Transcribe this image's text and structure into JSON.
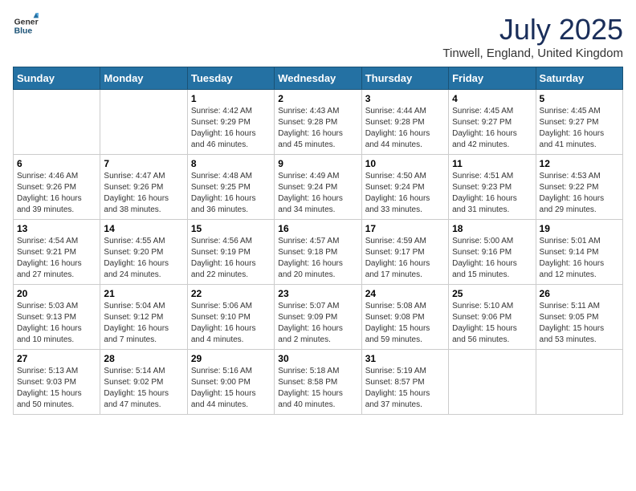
{
  "header": {
    "logo_line1": "General",
    "logo_line2": "Blue",
    "month_year": "July 2025",
    "location": "Tinwell, England, United Kingdom"
  },
  "weekdays": [
    "Sunday",
    "Monday",
    "Tuesday",
    "Wednesday",
    "Thursday",
    "Friday",
    "Saturday"
  ],
  "weeks": [
    [
      {
        "day": "",
        "empty": true
      },
      {
        "day": "",
        "empty": true
      },
      {
        "day": "1",
        "sunrise": "4:42 AM",
        "sunset": "9:29 PM",
        "daylight": "16 hours and 46 minutes."
      },
      {
        "day": "2",
        "sunrise": "4:43 AM",
        "sunset": "9:28 PM",
        "daylight": "16 hours and 45 minutes."
      },
      {
        "day": "3",
        "sunrise": "4:44 AM",
        "sunset": "9:28 PM",
        "daylight": "16 hours and 44 minutes."
      },
      {
        "day": "4",
        "sunrise": "4:45 AM",
        "sunset": "9:27 PM",
        "daylight": "16 hours and 42 minutes."
      },
      {
        "day": "5",
        "sunrise": "4:45 AM",
        "sunset": "9:27 PM",
        "daylight": "16 hours and 41 minutes."
      }
    ],
    [
      {
        "day": "6",
        "sunrise": "4:46 AM",
        "sunset": "9:26 PM",
        "daylight": "16 hours and 39 minutes."
      },
      {
        "day": "7",
        "sunrise": "4:47 AM",
        "sunset": "9:26 PM",
        "daylight": "16 hours and 38 minutes."
      },
      {
        "day": "8",
        "sunrise": "4:48 AM",
        "sunset": "9:25 PM",
        "daylight": "16 hours and 36 minutes."
      },
      {
        "day": "9",
        "sunrise": "4:49 AM",
        "sunset": "9:24 PM",
        "daylight": "16 hours and 34 minutes."
      },
      {
        "day": "10",
        "sunrise": "4:50 AM",
        "sunset": "9:24 PM",
        "daylight": "16 hours and 33 minutes."
      },
      {
        "day": "11",
        "sunrise": "4:51 AM",
        "sunset": "9:23 PM",
        "daylight": "16 hours and 31 minutes."
      },
      {
        "day": "12",
        "sunrise": "4:53 AM",
        "sunset": "9:22 PM",
        "daylight": "16 hours and 29 minutes."
      }
    ],
    [
      {
        "day": "13",
        "sunrise": "4:54 AM",
        "sunset": "9:21 PM",
        "daylight": "16 hours and 27 minutes."
      },
      {
        "day": "14",
        "sunrise": "4:55 AM",
        "sunset": "9:20 PM",
        "daylight": "16 hours and 24 minutes."
      },
      {
        "day": "15",
        "sunrise": "4:56 AM",
        "sunset": "9:19 PM",
        "daylight": "16 hours and 22 minutes."
      },
      {
        "day": "16",
        "sunrise": "4:57 AM",
        "sunset": "9:18 PM",
        "daylight": "16 hours and 20 minutes."
      },
      {
        "day": "17",
        "sunrise": "4:59 AM",
        "sunset": "9:17 PM",
        "daylight": "16 hours and 17 minutes."
      },
      {
        "day": "18",
        "sunrise": "5:00 AM",
        "sunset": "9:16 PM",
        "daylight": "16 hours and 15 minutes."
      },
      {
        "day": "19",
        "sunrise": "5:01 AM",
        "sunset": "9:14 PM",
        "daylight": "16 hours and 12 minutes."
      }
    ],
    [
      {
        "day": "20",
        "sunrise": "5:03 AM",
        "sunset": "9:13 PM",
        "daylight": "16 hours and 10 minutes."
      },
      {
        "day": "21",
        "sunrise": "5:04 AM",
        "sunset": "9:12 PM",
        "daylight": "16 hours and 7 minutes."
      },
      {
        "day": "22",
        "sunrise": "5:06 AM",
        "sunset": "9:10 PM",
        "daylight": "16 hours and 4 minutes."
      },
      {
        "day": "23",
        "sunrise": "5:07 AM",
        "sunset": "9:09 PM",
        "daylight": "16 hours and 2 minutes."
      },
      {
        "day": "24",
        "sunrise": "5:08 AM",
        "sunset": "9:08 PM",
        "daylight": "15 hours and 59 minutes."
      },
      {
        "day": "25",
        "sunrise": "5:10 AM",
        "sunset": "9:06 PM",
        "daylight": "15 hours and 56 minutes."
      },
      {
        "day": "26",
        "sunrise": "5:11 AM",
        "sunset": "9:05 PM",
        "daylight": "15 hours and 53 minutes."
      }
    ],
    [
      {
        "day": "27",
        "sunrise": "5:13 AM",
        "sunset": "9:03 PM",
        "daylight": "15 hours and 50 minutes."
      },
      {
        "day": "28",
        "sunrise": "5:14 AM",
        "sunset": "9:02 PM",
        "daylight": "15 hours and 47 minutes."
      },
      {
        "day": "29",
        "sunrise": "5:16 AM",
        "sunset": "9:00 PM",
        "daylight": "15 hours and 44 minutes."
      },
      {
        "day": "30",
        "sunrise": "5:18 AM",
        "sunset": "8:58 PM",
        "daylight": "15 hours and 40 minutes."
      },
      {
        "day": "31",
        "sunrise": "5:19 AM",
        "sunset": "8:57 PM",
        "daylight": "15 hours and 37 minutes."
      },
      {
        "day": "",
        "empty": true
      },
      {
        "day": "",
        "empty": true
      }
    ]
  ]
}
